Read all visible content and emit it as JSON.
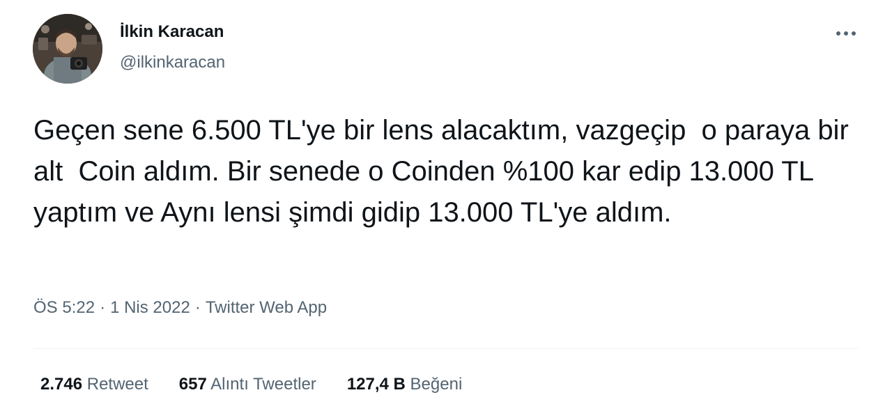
{
  "author": {
    "display_name": "İlkin Karacan",
    "handle": "@ilkinkaracan",
    "avatar_icon": "profile-photo"
  },
  "tweet": {
    "text": "Geçen sene 6.500 TL'ye bir lens alacaktım, vazgeçip  o paraya bir alt  Coin aldım. Bir senede o Coinden %100 kar edip 13.000 TL yaptım ve Aynı lensi şimdi gidip 13.000 TL'ye aldım.",
    "time": "ÖS 5:22",
    "date": "1 Nis 2022",
    "source": "Twitter Web App",
    "separator": "·"
  },
  "stats": {
    "retweets_count": "2.746",
    "retweets_label": "Retweet",
    "quotes_count": "657",
    "quotes_label": "Alıntı Tweetler",
    "likes_count": "127,4 B",
    "likes_label": "Beğeni"
  },
  "menu": {
    "more_icon": "more-horizontal-icon"
  },
  "colors": {
    "text_primary": "#0f1419",
    "text_secondary": "#536471",
    "divider": "#eff3f4",
    "background": "#ffffff"
  }
}
